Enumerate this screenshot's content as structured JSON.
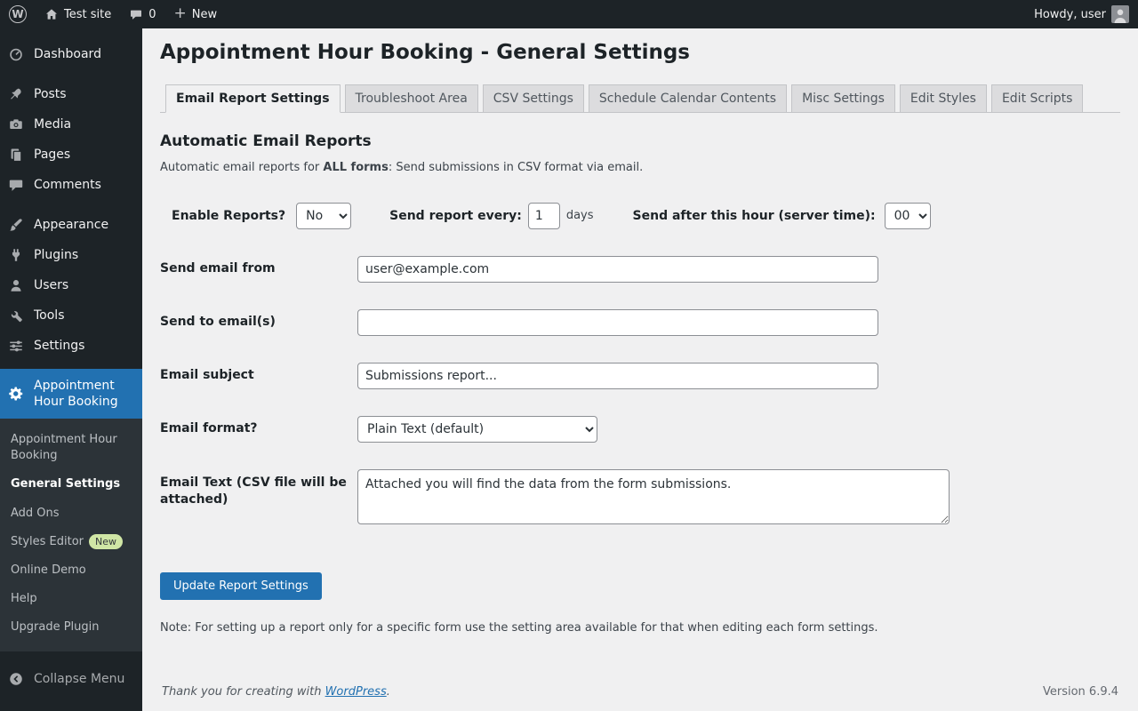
{
  "admin_bar": {
    "site_name": "Test site",
    "comments_count": "0",
    "new_label": "New",
    "howdy": "Howdy, user"
  },
  "sidebar": {
    "items": [
      {
        "label": "Dashboard"
      },
      {
        "label": "Posts"
      },
      {
        "label": "Media"
      },
      {
        "label": "Pages"
      },
      {
        "label": "Comments"
      },
      {
        "label": "Appearance"
      },
      {
        "label": "Plugins"
      },
      {
        "label": "Users"
      },
      {
        "label": "Tools"
      },
      {
        "label": "Settings"
      }
    ],
    "active_item": "Appointment Hour Booking",
    "submenu": [
      {
        "label": "Appointment Hour Booking"
      },
      {
        "label": "General Settings"
      },
      {
        "label": "Add Ons"
      },
      {
        "label": "Styles Editor",
        "badge": "New"
      },
      {
        "label": "Online Demo"
      },
      {
        "label": "Help"
      },
      {
        "label": "Upgrade Plugin"
      }
    ],
    "collapse_label": "Collapse Menu"
  },
  "page": {
    "title": "Appointment Hour Booking - General Settings",
    "tabs": [
      {
        "label": "Email Report Settings"
      },
      {
        "label": "Troubleshoot Area"
      },
      {
        "label": "CSV Settings"
      },
      {
        "label": "Schedule Calendar Contents"
      },
      {
        "label": "Misc Settings"
      },
      {
        "label": "Edit Styles"
      },
      {
        "label": "Edit Scripts"
      }
    ],
    "section_title": "Automatic Email Reports",
    "intro_prefix": "Automatic email reports for ",
    "intro_bold": "ALL forms",
    "intro_suffix": ": Send submissions in CSV format via email.",
    "fields": {
      "enable_label": "Enable Reports?",
      "enable_value": "No",
      "every_label": "Send report every:",
      "every_value": "1",
      "every_suffix": "days",
      "hour_label": "Send after this hour (server time):",
      "hour_value": "00",
      "from_label": "Send email from",
      "from_value": "user@example.com",
      "to_label": "Send to email(s)",
      "to_value": "",
      "subject_label": "Email subject",
      "subject_value": "Submissions report...",
      "format_label": "Email format?",
      "format_value": "Plain Text (default)",
      "text_label": "Email Text (CSV file will be attached)",
      "text_value": "Attached you will find the data from the form submissions."
    },
    "submit_label": "Update Report Settings",
    "note": "Note: For setting up a report only for a specific form use the setting area available for that when editing each form settings."
  },
  "footer": {
    "thanks_prefix": "Thank you for creating with ",
    "link_label": "WordPress",
    "thanks_suffix": ".",
    "version": "Version 6.9.4"
  },
  "colors": {
    "accent": "#2271b1",
    "sidebar_bg": "#1d2327",
    "submenu_bg": "#2c3338",
    "page_bg": "#f0f0f1"
  }
}
